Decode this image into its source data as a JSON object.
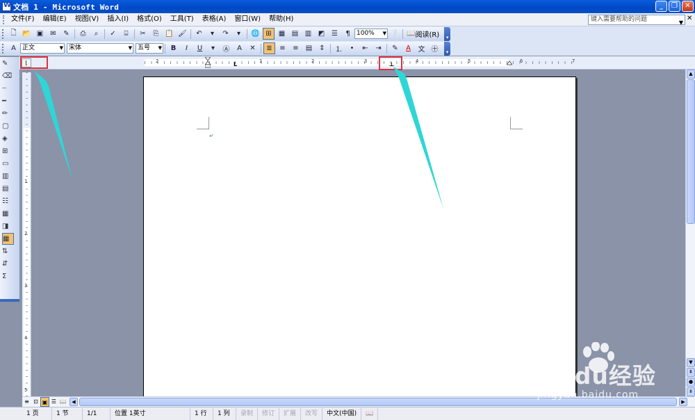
{
  "window": {
    "title": "文档 1 - Microsoft Word"
  },
  "menubar": {
    "items": [
      "文件(F)",
      "编辑(E)",
      "视图(V)",
      "插入(I)",
      "格式(O)",
      "工具(T)",
      "表格(A)",
      "窗口(W)",
      "帮助(H)"
    ],
    "help_placeholder": "键入需要帮助的问题"
  },
  "standard_toolbar": {
    "zoom": "100%",
    "read_label": "阅读(R)"
  },
  "format_toolbar": {
    "style": "正文",
    "font": "宋体",
    "size": "五号"
  },
  "ruler": {
    "h_numbers": [
      "2",
      "1",
      "1",
      "2",
      "3",
      "4",
      "5",
      "6",
      "7"
    ],
    "v_numbers": [
      "1",
      "1",
      "2",
      "3",
      "4",
      "5"
    ],
    "tab_selector": "⌊"
  },
  "statusbar": {
    "page": "1 页",
    "section": "1 节",
    "page_of": "1/1",
    "position": "位置 1英寸",
    "line": "1 行",
    "column": "1 列",
    "rec": "录制",
    "trk": "修订",
    "ext": "扩展",
    "ovr": "改写",
    "language": "中文(中国)"
  },
  "watermark": {
    "brand": "Baidu经验",
    "url": "jingyan.baidu.com"
  },
  "colors": {
    "annotation_box": "#e0313a",
    "annotation_arrow": "#2fd6d6",
    "titlebar": "#0a5ddb"
  }
}
